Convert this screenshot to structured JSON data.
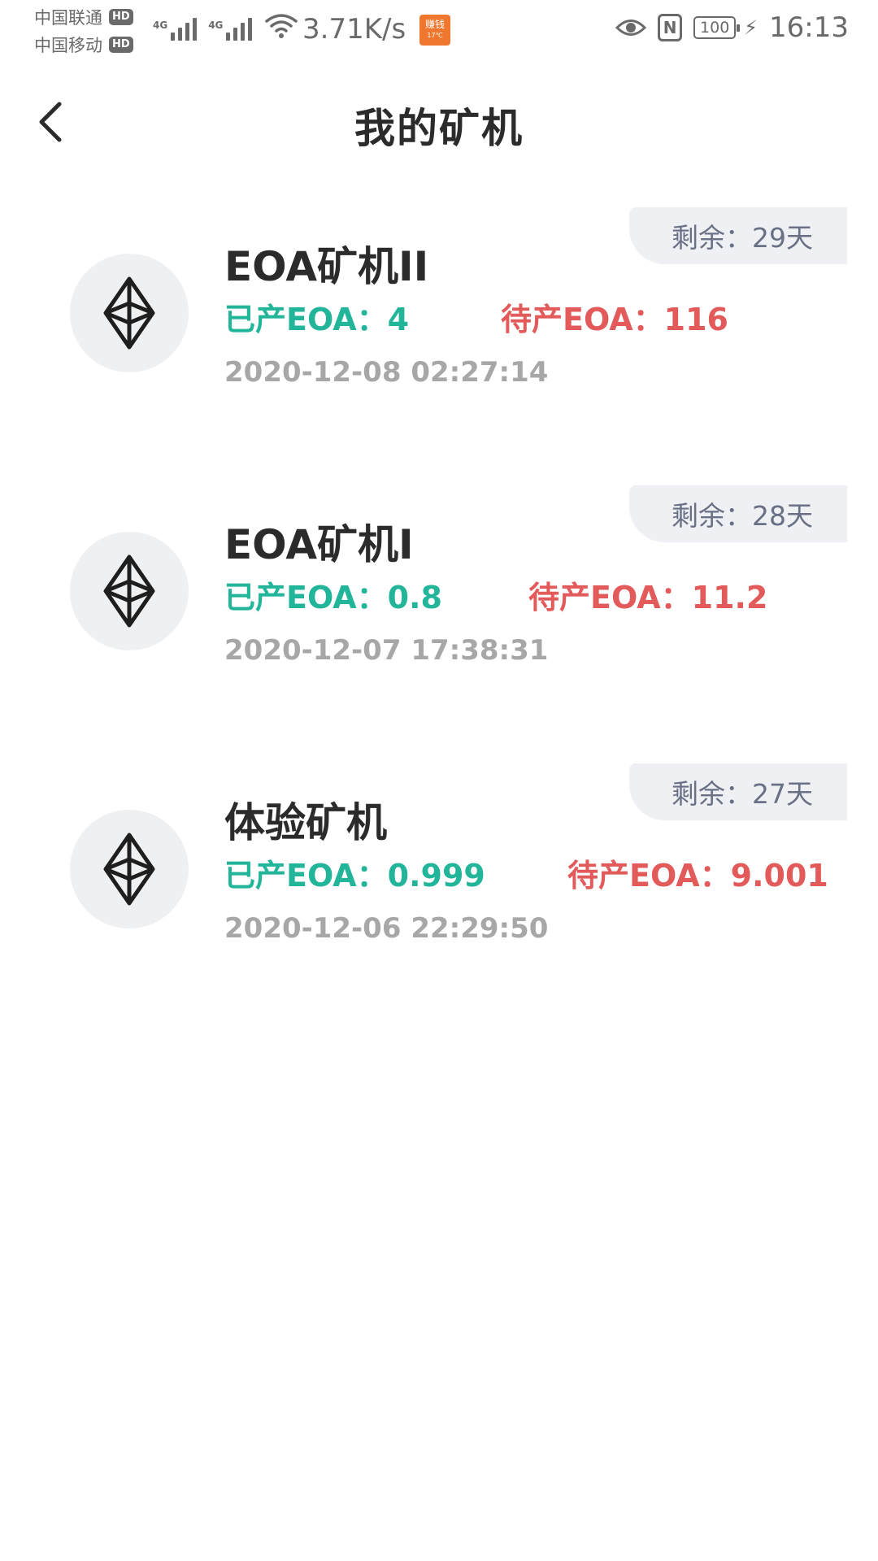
{
  "status_bar": {
    "carrier1": "中国联通",
    "carrier2": "中国移动",
    "hd": "HD",
    "net_type": "4G",
    "speed": "3.71K/s",
    "app_badge_line1": "赚钱",
    "app_badge_line2": "17℃",
    "nfc": "N",
    "battery": "100",
    "time": "16:13",
    "icons": [
      "signal-icon",
      "wifi-icon",
      "eye-icon",
      "nfc-icon",
      "battery-icon",
      "charging-icon"
    ]
  },
  "header": {
    "title": "我的矿机",
    "back_icon": "chevron-left-icon"
  },
  "miners": [
    {
      "name": "EOA矿机II",
      "remaining": "剩余：29天",
      "produced": "已产EOA：4",
      "pending": "待产EOA：116",
      "date": "2020-12-08 02:27:14",
      "icon": "ethereum-icon"
    },
    {
      "name": "EOA矿机I",
      "remaining": "剩余：28天",
      "produced": "已产EOA：0.8",
      "pending": "待产EOA：11.2",
      "date": "2020-12-07 17:38:31",
      "icon": "ethereum-icon"
    },
    {
      "name": "体验矿机",
      "remaining": "剩余：27天",
      "produced": "已产EOA：0.999",
      "pending": "待产EOA：9.001",
      "date": "2020-12-06 22:29:50",
      "icon": "ethereum-icon"
    }
  ],
  "colors": {
    "produced": "#22b59a",
    "pending": "#e25a5a",
    "date": "#a7a7a7",
    "badge_bg": "#eef0f4"
  }
}
